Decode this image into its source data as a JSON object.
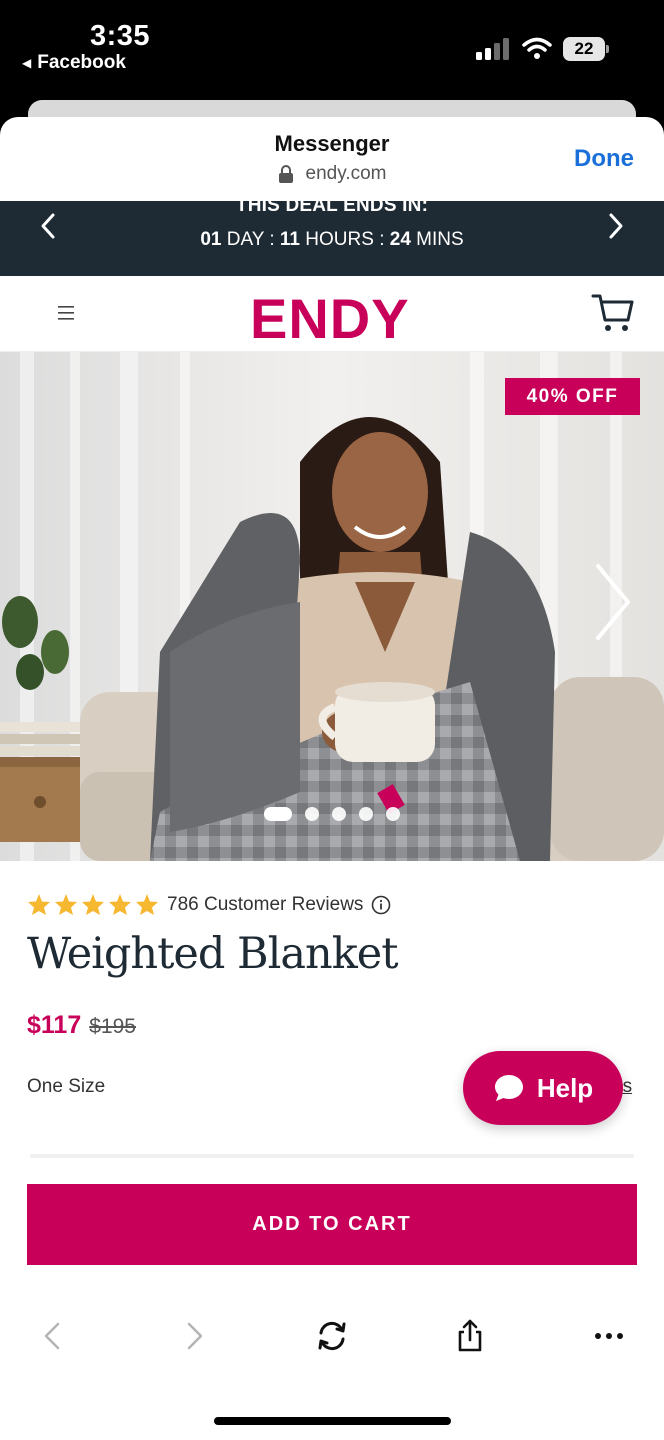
{
  "status_bar": {
    "time": "3:35",
    "back_app": "Facebook",
    "battery": "22",
    "icons": [
      "signal-icon",
      "wifi-icon",
      "battery-icon"
    ]
  },
  "browser": {
    "title": "Messenger",
    "url": "endy.com",
    "done_label": "Done"
  },
  "deal_banner": {
    "title": "THIS DEAL ENDS IN:",
    "days": "01",
    "days_unit": "DAY",
    "hours": "11",
    "hours_unit": "HOURS",
    "mins": "24",
    "mins_unit": "MINS",
    "sep": ":"
  },
  "site_header": {
    "logo": "ENDY"
  },
  "hero": {
    "badge": "40% OFF",
    "slide_count": 5,
    "active_slide": 1
  },
  "product": {
    "stars": 5,
    "reviews": "786 Customer Reviews",
    "title": "Weighted Blanket",
    "price_now": "$117",
    "price_was": "$195",
    "size": "One Size",
    "dimensions_partial": "ns",
    "add_to_cart": "ADD TO CART"
  },
  "help": {
    "label": "Help"
  },
  "colors": {
    "brand": "#c8005a",
    "banner": "#1e2a34",
    "link_blue": "#1a6fd8",
    "star": "#f6b830"
  }
}
